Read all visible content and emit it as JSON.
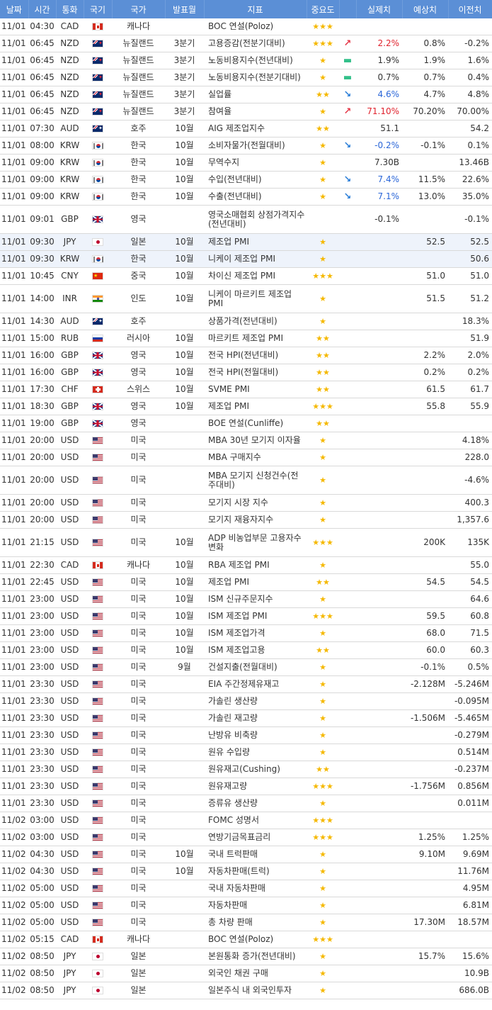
{
  "headers": [
    "날짜",
    "시간",
    "통화",
    "국기",
    "국가",
    "발표월",
    "지표",
    "중요도",
    "",
    "실제치",
    "예상치",
    "이전치"
  ],
  "rows": [
    {
      "date": "11/01",
      "time": "04:30",
      "currency": "CAD",
      "flag": "CA",
      "country": "캐나다",
      "month": "",
      "indicator": "BOC 연설(Poloz)",
      "stars": 3,
      "trend": "",
      "actual": "",
      "forecast": "",
      "previous": ""
    },
    {
      "date": "11/01",
      "time": "06:45",
      "currency": "NZD",
      "flag": "NZ",
      "country": "뉴질랜드",
      "month": "3분기",
      "indicator": "고용증감(전분기대비)",
      "stars": 3,
      "trend": "up",
      "actual": "2.2%",
      "forecast": "0.8%",
      "previous": "-0.2%"
    },
    {
      "date": "11/01",
      "time": "06:45",
      "currency": "NZD",
      "flag": "NZ",
      "country": "뉴질랜드",
      "month": "3분기",
      "indicator": "노동비용지수(전년대비)",
      "stars": 1,
      "trend": "flat",
      "actual": "1.9%",
      "forecast": "1.9%",
      "previous": "1.6%"
    },
    {
      "date": "11/01",
      "time": "06:45",
      "currency": "NZD",
      "flag": "NZ",
      "country": "뉴질랜드",
      "month": "3분기",
      "indicator": "노동비용지수(전분기대비)",
      "stars": 1,
      "trend": "flat",
      "actual": "0.7%",
      "forecast": "0.7%",
      "previous": "0.4%"
    },
    {
      "date": "11/01",
      "time": "06:45",
      "currency": "NZD",
      "flag": "NZ",
      "country": "뉴질랜드",
      "month": "3분기",
      "indicator": "실업률",
      "stars": 2,
      "trend": "down",
      "actual": "4.6%",
      "forecast": "4.7%",
      "previous": "4.8%"
    },
    {
      "date": "11/01",
      "time": "06:45",
      "currency": "NZD",
      "flag": "NZ",
      "country": "뉴질랜드",
      "month": "3분기",
      "indicator": "참여율",
      "stars": 1,
      "trend": "up",
      "actual": "71.10%",
      "forecast": "70.20%",
      "previous": "70.00%"
    },
    {
      "date": "11/01",
      "time": "07:30",
      "currency": "AUD",
      "flag": "AU",
      "country": "호주",
      "month": "10월",
      "indicator": "AIG 제조업지수",
      "stars": 2,
      "trend": "",
      "actual": "51.1",
      "forecast": "",
      "previous": "54.2"
    },
    {
      "date": "11/01",
      "time": "08:00",
      "currency": "KRW",
      "flag": "KR",
      "country": "한국",
      "month": "10월",
      "indicator": "소비자물가(전월대비)",
      "stars": 1,
      "trend": "down",
      "actual": "-0.2%",
      "forecast": "-0.1%",
      "previous": "0.1%"
    },
    {
      "date": "11/01",
      "time": "09:00",
      "currency": "KRW",
      "flag": "KR",
      "country": "한국",
      "month": "10월",
      "indicator": "무역수지",
      "stars": 1,
      "trend": "",
      "actual": "7.30B",
      "forecast": "",
      "previous": "13.46B"
    },
    {
      "date": "11/01",
      "time": "09:00",
      "currency": "KRW",
      "flag": "KR",
      "country": "한국",
      "month": "10월",
      "indicator": "수입(전년대비)",
      "stars": 1,
      "trend": "down",
      "actual": "7.4%",
      "forecast": "11.5%",
      "previous": "22.6%"
    },
    {
      "date": "11/01",
      "time": "09:00",
      "currency": "KRW",
      "flag": "KR",
      "country": "한국",
      "month": "10월",
      "indicator": "수출(전년대비)",
      "stars": 1,
      "trend": "down",
      "actual": "7.1%",
      "forecast": "13.0%",
      "previous": "35.0%"
    },
    {
      "date": "11/01",
      "time": "09:01",
      "currency": "GBP",
      "flag": "GB",
      "country": "영국",
      "month": "",
      "indicator": "영국소매협회 상점가격지수(전년대비)",
      "stars": 0,
      "trend": "",
      "actual": "-0.1%",
      "forecast": "",
      "previous": "-0.1%",
      "tall": true
    },
    {
      "date": "11/01",
      "time": "09:30",
      "currency": "JPY",
      "flag": "JP",
      "country": "일본",
      "month": "10월",
      "indicator": "제조업 PMI",
      "stars": 1,
      "trend": "",
      "actual": "",
      "forecast": "52.5",
      "previous": "52.5",
      "hl": true
    },
    {
      "date": "11/01",
      "time": "09:30",
      "currency": "KRW",
      "flag": "KR",
      "country": "한국",
      "month": "10월",
      "indicator": "니케이 제조업 PMI",
      "stars": 1,
      "trend": "",
      "actual": "",
      "forecast": "",
      "previous": "50.6",
      "hl": true
    },
    {
      "date": "11/01",
      "time": "10:45",
      "currency": "CNY",
      "flag": "CN",
      "country": "중국",
      "month": "10월",
      "indicator": "차이신 제조업 PMI",
      "stars": 3,
      "trend": "",
      "actual": "",
      "forecast": "51.0",
      "previous": "51.0"
    },
    {
      "date": "11/01",
      "time": "14:00",
      "currency": "INR",
      "flag": "IN",
      "country": "인도",
      "month": "10월",
      "indicator": "니케이 마르키트 제조업 PMI",
      "stars": 1,
      "trend": "",
      "actual": "",
      "forecast": "51.5",
      "previous": "51.2",
      "tall": true
    },
    {
      "date": "11/01",
      "time": "14:30",
      "currency": "AUD",
      "flag": "AU",
      "country": "호주",
      "month": "",
      "indicator": "상품가격(전년대비)",
      "stars": 1,
      "trend": "",
      "actual": "",
      "forecast": "",
      "previous": "18.3%"
    },
    {
      "date": "11/01",
      "time": "15:00",
      "currency": "RUB",
      "flag": "RU",
      "country": "러시아",
      "month": "10월",
      "indicator": "마르키트 제조업 PMI",
      "stars": 2,
      "trend": "",
      "actual": "",
      "forecast": "",
      "previous": "51.9"
    },
    {
      "date": "11/01",
      "time": "16:00",
      "currency": "GBP",
      "flag": "GB",
      "country": "영국",
      "month": "10월",
      "indicator": "전국 HPI(전년대비)",
      "stars": 2,
      "trend": "",
      "actual": "",
      "forecast": "2.2%",
      "previous": "2.0%"
    },
    {
      "date": "11/01",
      "time": "16:00",
      "currency": "GBP",
      "flag": "GB",
      "country": "영국",
      "month": "10월",
      "indicator": "전국 HPI(전월대비)",
      "stars": 2,
      "trend": "",
      "actual": "",
      "forecast": "0.2%",
      "previous": "0.2%"
    },
    {
      "date": "11/01",
      "time": "17:30",
      "currency": "CHF",
      "flag": "CH",
      "country": "스위스",
      "month": "10월",
      "indicator": "SVME PMI",
      "stars": 2,
      "trend": "",
      "actual": "",
      "forecast": "61.5",
      "previous": "61.7"
    },
    {
      "date": "11/01",
      "time": "18:30",
      "currency": "GBP",
      "flag": "GB",
      "country": "영국",
      "month": "10월",
      "indicator": "제조업 PMI",
      "stars": 3,
      "trend": "",
      "actual": "",
      "forecast": "55.8",
      "previous": "55.9"
    },
    {
      "date": "11/01",
      "time": "19:00",
      "currency": "GBP",
      "flag": "GB",
      "country": "영국",
      "month": "",
      "indicator": "BOE 연설(Cunliffe)",
      "stars": 2,
      "trend": "",
      "actual": "",
      "forecast": "",
      "previous": ""
    },
    {
      "date": "11/01",
      "time": "20:00",
      "currency": "USD",
      "flag": "US",
      "country": "미국",
      "month": "",
      "indicator": "MBA 30년 모기지 이자율",
      "stars": 1,
      "trend": "",
      "actual": "",
      "forecast": "",
      "previous": "4.18%"
    },
    {
      "date": "11/01",
      "time": "20:00",
      "currency": "USD",
      "flag": "US",
      "country": "미국",
      "month": "",
      "indicator": "MBA 구매지수",
      "stars": 1,
      "trend": "",
      "actual": "",
      "forecast": "",
      "previous": "228.0"
    },
    {
      "date": "11/01",
      "time": "20:00",
      "currency": "USD",
      "flag": "US",
      "country": "미국",
      "month": "",
      "indicator": "MBA 모기지 신청건수(전주대비)",
      "stars": 1,
      "trend": "",
      "actual": "",
      "forecast": "",
      "previous": "-4.6%",
      "tall": true
    },
    {
      "date": "11/01",
      "time": "20:00",
      "currency": "USD",
      "flag": "US",
      "country": "미국",
      "month": "",
      "indicator": "모기지 시장 지수",
      "stars": 1,
      "trend": "",
      "actual": "",
      "forecast": "",
      "previous": "400.3"
    },
    {
      "date": "11/01",
      "time": "20:00",
      "currency": "USD",
      "flag": "US",
      "country": "미국",
      "month": "",
      "indicator": "모기지 재융자지수",
      "stars": 1,
      "trend": "",
      "actual": "",
      "forecast": "",
      "previous": "1,357.6"
    },
    {
      "date": "11/01",
      "time": "21:15",
      "currency": "USD",
      "flag": "US",
      "country": "미국",
      "month": "10월",
      "indicator": "ADP 비농업부문 고용자수 변화",
      "stars": 3,
      "trend": "",
      "actual": "",
      "forecast": "200K",
      "previous": "135K",
      "tall": true
    },
    {
      "date": "11/01",
      "time": "22:30",
      "currency": "CAD",
      "flag": "CA",
      "country": "캐나다",
      "month": "10월",
      "indicator": "RBA 제조업 PMI",
      "stars": 1,
      "trend": "",
      "actual": "",
      "forecast": "",
      "previous": "55.0"
    },
    {
      "date": "11/01",
      "time": "22:45",
      "currency": "USD",
      "flag": "US",
      "country": "미국",
      "month": "10월",
      "indicator": "제조업 PMI",
      "stars": 2,
      "trend": "",
      "actual": "",
      "forecast": "54.5",
      "previous": "54.5"
    },
    {
      "date": "11/01",
      "time": "23:00",
      "currency": "USD",
      "flag": "US",
      "country": "미국",
      "month": "10월",
      "indicator": "ISM 신규주문지수",
      "stars": 1,
      "trend": "",
      "actual": "",
      "forecast": "",
      "previous": "64.6"
    },
    {
      "date": "11/01",
      "time": "23:00",
      "currency": "USD",
      "flag": "US",
      "country": "미국",
      "month": "10월",
      "indicator": "ISM 제조업 PMI",
      "stars": 3,
      "trend": "",
      "actual": "",
      "forecast": "59.5",
      "previous": "60.8"
    },
    {
      "date": "11/01",
      "time": "23:00",
      "currency": "USD",
      "flag": "US",
      "country": "미국",
      "month": "10월",
      "indicator": "ISM 제조업가격",
      "stars": 1,
      "trend": "",
      "actual": "",
      "forecast": "68.0",
      "previous": "71.5"
    },
    {
      "date": "11/01",
      "time": "23:00",
      "currency": "USD",
      "flag": "US",
      "country": "미국",
      "month": "10월",
      "indicator": "ISM 제조업고용",
      "stars": 2,
      "trend": "",
      "actual": "",
      "forecast": "60.0",
      "previous": "60.3"
    },
    {
      "date": "11/01",
      "time": "23:00",
      "currency": "USD",
      "flag": "US",
      "country": "미국",
      "month": "9월",
      "indicator": "건설지출(전월대비)",
      "stars": 1,
      "trend": "",
      "actual": "",
      "forecast": "-0.1%",
      "previous": "0.5%"
    },
    {
      "date": "11/01",
      "time": "23:30",
      "currency": "USD",
      "flag": "US",
      "country": "미국",
      "month": "",
      "indicator": "EIA 주간정제유재고",
      "stars": 1,
      "trend": "",
      "actual": "",
      "forecast": "-2.128M",
      "previous": "-5.246M"
    },
    {
      "date": "11/01",
      "time": "23:30",
      "currency": "USD",
      "flag": "US",
      "country": "미국",
      "month": "",
      "indicator": "가솔린 생산량",
      "stars": 1,
      "trend": "",
      "actual": "",
      "forecast": "",
      "previous": "-0.095M"
    },
    {
      "date": "11/01",
      "time": "23:30",
      "currency": "USD",
      "flag": "US",
      "country": "미국",
      "month": "",
      "indicator": "가솔린 재고량",
      "stars": 1,
      "trend": "",
      "actual": "",
      "forecast": "-1.506M",
      "previous": "-5.465M"
    },
    {
      "date": "11/01",
      "time": "23:30",
      "currency": "USD",
      "flag": "US",
      "country": "미국",
      "month": "",
      "indicator": "난방유 비축량",
      "stars": 1,
      "trend": "",
      "actual": "",
      "forecast": "",
      "previous": "-0.279M"
    },
    {
      "date": "11/01",
      "time": "23:30",
      "currency": "USD",
      "flag": "US",
      "country": "미국",
      "month": "",
      "indicator": "원유 수입량",
      "stars": 1,
      "trend": "",
      "actual": "",
      "forecast": "",
      "previous": "0.514M"
    },
    {
      "date": "11/01",
      "time": "23:30",
      "currency": "USD",
      "flag": "US",
      "country": "미국",
      "month": "",
      "indicator": "원유재고(Cushing)",
      "stars": 2,
      "trend": "",
      "actual": "",
      "forecast": "",
      "previous": "-0.237M"
    },
    {
      "date": "11/01",
      "time": "23:30",
      "currency": "USD",
      "flag": "US",
      "country": "미국",
      "month": "",
      "indicator": "원유재고량",
      "stars": 3,
      "trend": "",
      "actual": "",
      "forecast": "-1.756M",
      "previous": "0.856M"
    },
    {
      "date": "11/01",
      "time": "23:30",
      "currency": "USD",
      "flag": "US",
      "country": "미국",
      "month": "",
      "indicator": "증류유 생산량",
      "stars": 1,
      "trend": "",
      "actual": "",
      "forecast": "",
      "previous": "0.011M"
    },
    {
      "date": "11/02",
      "time": "03:00",
      "currency": "USD",
      "flag": "US",
      "country": "미국",
      "month": "",
      "indicator": "FOMC 성명서",
      "stars": 3,
      "trend": "",
      "actual": "",
      "forecast": "",
      "previous": ""
    },
    {
      "date": "11/02",
      "time": "03:00",
      "currency": "USD",
      "flag": "US",
      "country": "미국",
      "month": "",
      "indicator": "연방기금목표금리",
      "stars": 3,
      "trend": "",
      "actual": "",
      "forecast": "1.25%",
      "previous": "1.25%"
    },
    {
      "date": "11/02",
      "time": "04:30",
      "currency": "USD",
      "flag": "US",
      "country": "미국",
      "month": "10월",
      "indicator": "국내 트럭판매",
      "stars": 1,
      "trend": "",
      "actual": "",
      "forecast": "9.10M",
      "previous": "9.69M"
    },
    {
      "date": "11/02",
      "time": "04:30",
      "currency": "USD",
      "flag": "US",
      "country": "미국",
      "month": "10월",
      "indicator": "자동차판매(트럭)",
      "stars": 1,
      "trend": "",
      "actual": "",
      "forecast": "",
      "previous": "11.76M"
    },
    {
      "date": "11/02",
      "time": "05:00",
      "currency": "USD",
      "flag": "US",
      "country": "미국",
      "month": "",
      "indicator": "국내 자동차판매",
      "stars": 1,
      "trend": "",
      "actual": "",
      "forecast": "",
      "previous": "4.95M"
    },
    {
      "date": "11/02",
      "time": "05:00",
      "currency": "USD",
      "flag": "US",
      "country": "미국",
      "month": "",
      "indicator": "자동차판매",
      "stars": 1,
      "trend": "",
      "actual": "",
      "forecast": "",
      "previous": "6.81M"
    },
    {
      "date": "11/02",
      "time": "05:00",
      "currency": "USD",
      "flag": "US",
      "country": "미국",
      "month": "",
      "indicator": "총 차량 판매",
      "stars": 1,
      "trend": "",
      "actual": "",
      "forecast": "17.30M",
      "previous": "18.57M"
    },
    {
      "date": "11/02",
      "time": "05:15",
      "currency": "CAD",
      "flag": "CA",
      "country": "캐나다",
      "month": "",
      "indicator": "BOC 연설(Poloz)",
      "stars": 3,
      "trend": "",
      "actual": "",
      "forecast": "",
      "previous": ""
    },
    {
      "date": "11/02",
      "time": "08:50",
      "currency": "JPY",
      "flag": "JP",
      "country": "일본",
      "month": "",
      "indicator": "본원통화 증가(전년대비)",
      "stars": 1,
      "trend": "",
      "actual": "",
      "forecast": "15.7%",
      "previous": "15.6%"
    },
    {
      "date": "11/02",
      "time": "08:50",
      "currency": "JPY",
      "flag": "JP",
      "country": "일본",
      "month": "",
      "indicator": "외국인 채권 구매",
      "stars": 1,
      "trend": "",
      "actual": "",
      "forecast": "",
      "previous": "10.9B"
    },
    {
      "date": "11/02",
      "time": "08:50",
      "currency": "JPY",
      "flag": "JP",
      "country": "일본",
      "month": "",
      "indicator": "일본주식 내 외국인투자",
      "stars": 1,
      "trend": "",
      "actual": "",
      "forecast": "",
      "previous": "686.0B"
    }
  ],
  "colors": {
    "header_bg": "#5b8fd6",
    "star": "#f5b800",
    "up": "#e0232e",
    "down": "#2a66d8",
    "flat": "#33c08a"
  }
}
